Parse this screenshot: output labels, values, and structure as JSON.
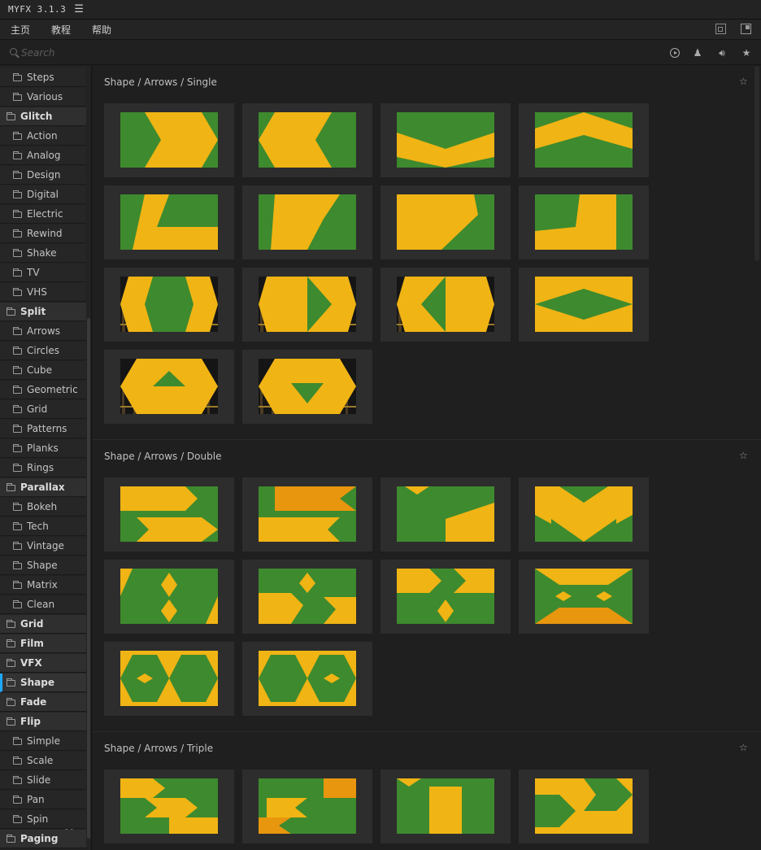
{
  "app": {
    "title": "MYFX 3.1.3"
  },
  "menu": {
    "items": [
      "主页",
      "教程",
      "帮助"
    ]
  },
  "search": {
    "placeholder": "Search"
  },
  "sidebar": {
    "items": [
      {
        "label": "Steps",
        "kind": "child"
      },
      {
        "label": "Various",
        "kind": "child"
      },
      {
        "label": "Glitch",
        "kind": "group"
      },
      {
        "label": "Action",
        "kind": "child"
      },
      {
        "label": "Analog",
        "kind": "child"
      },
      {
        "label": "Design",
        "kind": "child"
      },
      {
        "label": "Digital",
        "kind": "child"
      },
      {
        "label": "Electric",
        "kind": "child"
      },
      {
        "label": "Rewind",
        "kind": "child"
      },
      {
        "label": "Shake",
        "kind": "child"
      },
      {
        "label": "TV",
        "kind": "child"
      },
      {
        "label": "VHS",
        "kind": "child"
      },
      {
        "label": "Split",
        "kind": "group"
      },
      {
        "label": "Arrows",
        "kind": "child"
      },
      {
        "label": "Circles",
        "kind": "child"
      },
      {
        "label": "Cube",
        "kind": "child"
      },
      {
        "label": "Geometric",
        "kind": "child"
      },
      {
        "label": "Grid",
        "kind": "child"
      },
      {
        "label": "Patterns",
        "kind": "child"
      },
      {
        "label": "Planks",
        "kind": "child"
      },
      {
        "label": "Rings",
        "kind": "child"
      },
      {
        "label": "Parallax",
        "kind": "group"
      },
      {
        "label": "Bokeh",
        "kind": "child"
      },
      {
        "label": "Tech",
        "kind": "child"
      },
      {
        "label": "Vintage",
        "kind": "child"
      },
      {
        "label": "Shape",
        "kind": "child"
      },
      {
        "label": "Matrix",
        "kind": "child"
      },
      {
        "label": "Clean",
        "kind": "child"
      },
      {
        "label": "Grid",
        "kind": "group"
      },
      {
        "label": "Film",
        "kind": "group"
      },
      {
        "label": "VFX",
        "kind": "group"
      },
      {
        "label": "Shape",
        "kind": "group",
        "active": true
      },
      {
        "label": "Fade",
        "kind": "group"
      },
      {
        "label": "Flip",
        "kind": "group"
      },
      {
        "label": "Simple",
        "kind": "child"
      },
      {
        "label": "Scale",
        "kind": "child"
      },
      {
        "label": "Slide",
        "kind": "child"
      },
      {
        "label": "Pan",
        "kind": "child"
      },
      {
        "label": "Spin",
        "kind": "child"
      },
      {
        "label": "Paging",
        "kind": "group"
      }
    ]
  },
  "sections": [
    {
      "title": "Shape / Arrows / Single",
      "count": 14
    },
    {
      "title": "Shape / Arrows / Double",
      "count": 10
    },
    {
      "title": "Shape / Arrows / Triple",
      "count": 4
    }
  ],
  "colors": {
    "yellow": "#f0b414",
    "orange": "#e8960e",
    "green": "#3e8a2e",
    "dark": "#151515",
    "accent": "#1ea7ff"
  }
}
